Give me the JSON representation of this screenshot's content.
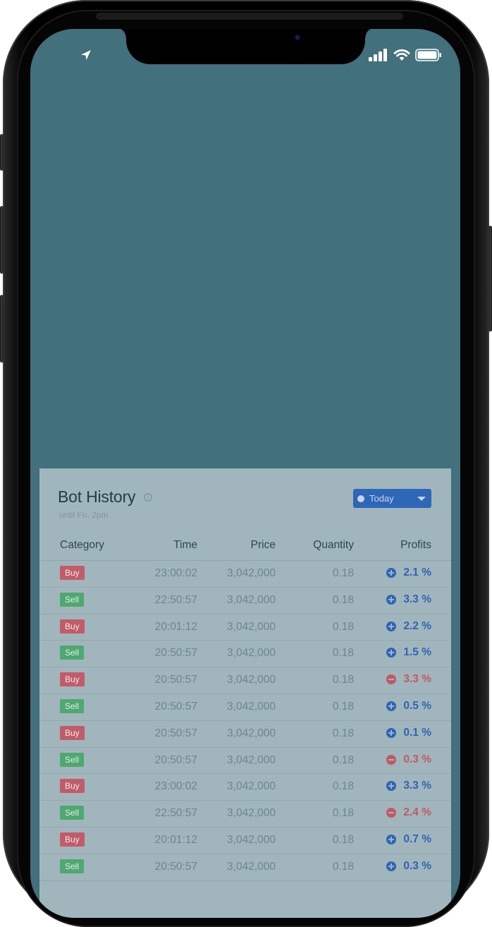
{
  "status_bar": {
    "location_icon": "location-arrow-icon",
    "signal_icon": "cellular-signal-icon",
    "wifi_icon": "wifi-icon",
    "battery_icon": "battery-icon"
  },
  "bot_history": {
    "title": "Bot History",
    "info_icon": "info-icon",
    "subtitle": "until Fri. 2pm",
    "filter": {
      "selected": "Today",
      "caret_icon": "caret-down-icon"
    },
    "columns": [
      "Category",
      "Time",
      "Price",
      "Quantity",
      "Profits"
    ],
    "rows": [
      {
        "category": "Buy",
        "time": "23:00:02",
        "price": "3,042,000",
        "quantity": "0.18",
        "profit": "2.1 %",
        "sign": "pos"
      },
      {
        "category": "Sell",
        "time": "22:50:57",
        "price": "3,042,000",
        "quantity": "0.18",
        "profit": "3.3 %",
        "sign": "pos"
      },
      {
        "category": "Buy",
        "time": "20:01:12",
        "price": "3,042,000",
        "quantity": "0.18",
        "profit": "2.2 %",
        "sign": "pos"
      },
      {
        "category": "Sell",
        "time": "20:50:57",
        "price": "3,042,000",
        "quantity": "0.18",
        "profit": "1.5 %",
        "sign": "pos"
      },
      {
        "category": "Buy",
        "time": "20:50:57",
        "price": "3,042,000",
        "quantity": "0.18",
        "profit": "3.3 %",
        "sign": "neg"
      },
      {
        "category": "Sell",
        "time": "20:50:57",
        "price": "3,042,000",
        "quantity": "0.18",
        "profit": "0.5 %",
        "sign": "pos"
      },
      {
        "category": "Buy",
        "time": "20:50:57",
        "price": "3,042,000",
        "quantity": "0.18",
        "profit": "0.1 %",
        "sign": "pos"
      },
      {
        "category": "Sell",
        "time": "20:50:57",
        "price": "3,042,000",
        "quantity": "0.18",
        "profit": "0.3 %",
        "sign": "neg"
      },
      {
        "category": "Buy",
        "time": "23:00:02",
        "price": "3,042,000",
        "quantity": "0.18",
        "profit": "3.3 %",
        "sign": "pos"
      },
      {
        "category": "Sell",
        "time": "22:50:57",
        "price": "3,042,000",
        "quantity": "0.18",
        "profit": "2.4 %",
        "sign": "neg"
      },
      {
        "category": "Buy",
        "time": "20:01:12",
        "price": "3,042,000",
        "quantity": "0.18",
        "profit": "0.7 %",
        "sign": "pos"
      },
      {
        "category": "Sell",
        "time": "20:50:57",
        "price": "3,042,000",
        "quantity": "0.18",
        "profit": "0.3 %",
        "sign": "pos"
      }
    ]
  },
  "colors": {
    "screen_bg": "#42707c",
    "panel_bg": "#a1b6bc",
    "buy": "#c25c68",
    "sell": "#4ea86f",
    "positive": "#2e63b8",
    "negative": "#c25865"
  }
}
